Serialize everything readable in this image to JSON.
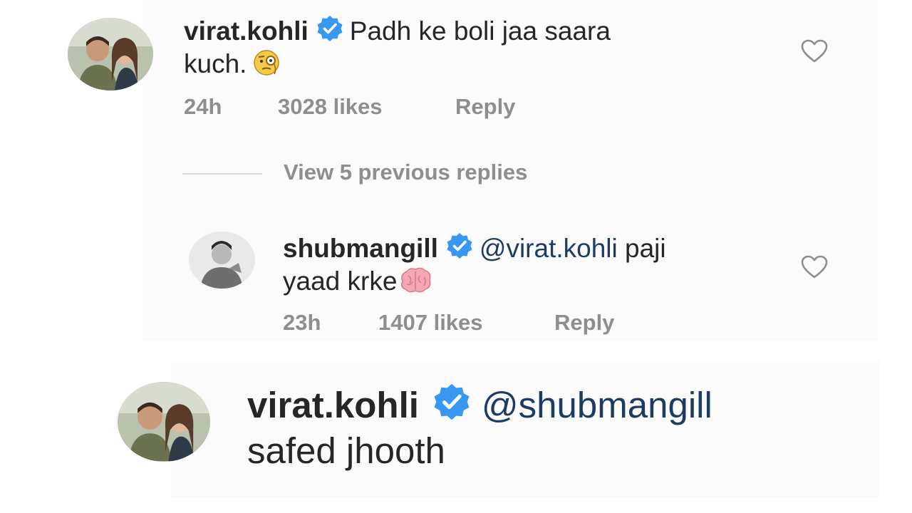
{
  "comments": [
    {
      "username": "virat.kohli",
      "text": "Padh ke boli jaa saara",
      "text_line2": "kuch.",
      "emoji": "face-with-monocle",
      "time": "24h",
      "likes": "3028 likes",
      "reply_label": "Reply"
    },
    {
      "username": "shubmangill",
      "mention": "@virat.kohli",
      "text": "paji",
      "text_line2": "yaad krke",
      "emoji": "brain",
      "time": "23h",
      "likes": "1407 likes",
      "reply_label": "Reply"
    },
    {
      "username": "virat.kohli",
      "mention": "@shubmangill",
      "text_line2": "safed jhooth"
    }
  ],
  "view_replies": "View 5 previous replies",
  "colors": {
    "verified": "#3897f0",
    "meta_text": "#8e8e8e",
    "mention": "#1e3b63"
  }
}
